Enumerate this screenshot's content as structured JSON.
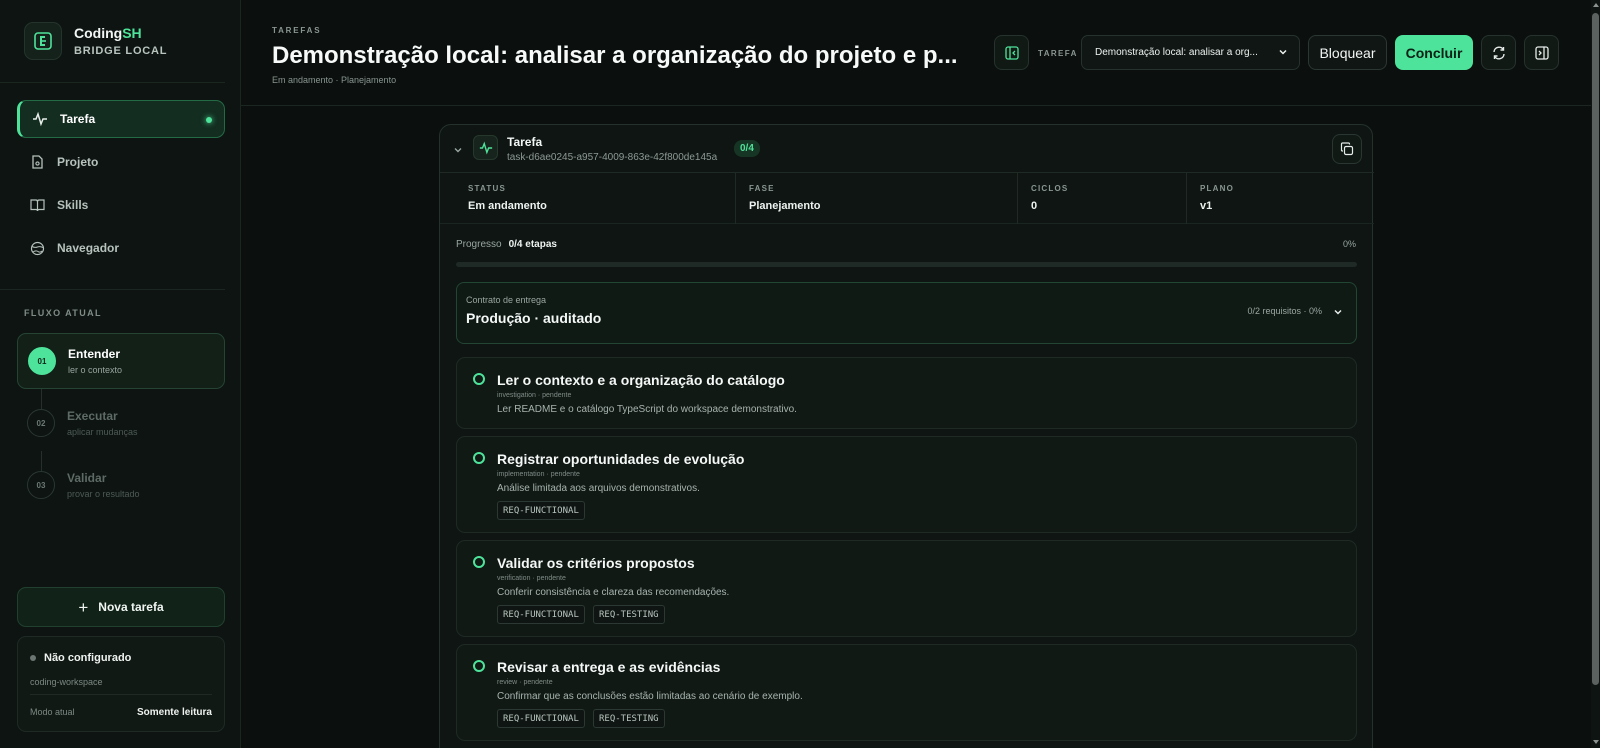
{
  "brand": {
    "name_prefix": "Coding",
    "name_accent": "SH",
    "subtitle": "BRIDGE LOCAL"
  },
  "sidebar": {
    "nav": [
      {
        "label": "Tarefa",
        "icon": "activity-icon",
        "active": true
      },
      {
        "label": "Projeto",
        "icon": "file-icon",
        "active": false
      },
      {
        "label": "Skills",
        "icon": "book-icon",
        "active": false
      },
      {
        "label": "Navegador",
        "icon": "globe-icon",
        "active": false
      }
    ],
    "flow_title": "FLUXO ATUAL",
    "flow": [
      {
        "num": "01",
        "title": "Entender",
        "sub": "ler o contexto",
        "active": true
      },
      {
        "num": "02",
        "title": "Executar",
        "sub": "aplicar mudanças",
        "active": false
      },
      {
        "num": "03",
        "title": "Validar",
        "sub": "provar o resultado",
        "active": false
      }
    ],
    "new_task_label": "Nova tarefa",
    "config": {
      "status": "Não configurado",
      "workspace": "coding-workspace",
      "mode_label": "Modo atual",
      "mode_value": "Somente leitura"
    }
  },
  "header": {
    "eyebrow": "TAREFAS",
    "title": "Demonstração local: analisar a organização do projeto e p...",
    "subtitle": "Em andamento · Planejamento",
    "task_label": "TAREFA",
    "task_select_value": "Demonstração local: analisar a org...",
    "block_label": "Bloquear",
    "done_label": "Concluir"
  },
  "task": {
    "title": "Tarefa",
    "id": "task-d6ae0245-a957-4009-863e-42f800de145a",
    "count_badge": "0/4",
    "stats": [
      {
        "label": "STATUS",
        "value": "Em andamento"
      },
      {
        "label": "FASE",
        "value": "Planejamento"
      },
      {
        "label": "CICLOS",
        "value": "0"
      },
      {
        "label": "PLANO",
        "value": "v1"
      }
    ],
    "progress_label": "Progresso",
    "progress_value": "0/4 etapas",
    "progress_pct": "0%",
    "progress_fraction": 0,
    "contract": {
      "label": "Contrato de entrega",
      "title": "Produção · auditado",
      "meta": "0/2 requisitos · 0%"
    },
    "steps": [
      {
        "title": "Ler o contexto e a organização do catálogo",
        "meta": "investigation · pendente",
        "desc": "Ler README e o catálogo TypeScript do workspace demonstrativo.",
        "tags": []
      },
      {
        "title": "Registrar oportunidades de evolução",
        "meta": "implementation · pendente",
        "desc": "Análise limitada aos arquivos demonstrativos.",
        "tags": [
          "REQ-FUNCTIONAL"
        ]
      },
      {
        "title": "Validar os critérios propostos",
        "meta": "verification · pendente",
        "desc": "Conferir consistência e clareza das recomendações.",
        "tags": [
          "REQ-FUNCTIONAL",
          "REQ-TESTING"
        ]
      },
      {
        "title": "Revisar a entrega e as evidências",
        "meta": "review · pendente",
        "desc": "Confirmar que as conclusões estão limitadas ao cenário de exemplo.",
        "tags": [
          "REQ-FUNCTIONAL",
          "REQ-TESTING"
        ]
      }
    ]
  },
  "colors": {
    "accent": "#4ee39a",
    "background": "#0b100e",
    "panel": "#0e1512"
  }
}
